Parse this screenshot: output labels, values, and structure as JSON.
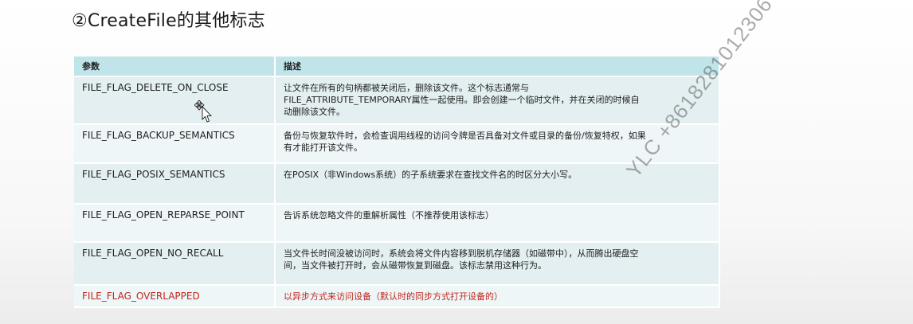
{
  "title": "②CreateFile的其他标志",
  "table": {
    "headers": {
      "param": "参数",
      "desc": "描述"
    },
    "rows": [
      {
        "flag": "FILE_FLAG_DELETE_ON_CLOSE",
        "desc_lines": [
          "让文件在所有的句柄都被关闭后，删除该文件。这个标志通常与",
          "FILE_ATTRIBUTE_TEMPORARY属性一起使用。即会创建一个临时文件，并在关闭的时候自",
          "动删除该文件。"
        ]
      },
      {
        "flag": "FILE_FLAG_BACKUP_SEMANTICS",
        "desc_lines": [
          "备份与恢复软件时，会检查调用线程的访问令牌是否具备对文件或目录的备份/恢复特权，如果",
          "有才能打开该文件。"
        ]
      },
      {
        "flag": "FILE_FLAG_POSIX_SEMANTICS",
        "desc_lines": [
          "在POSIX（非Windows系统）的子系统要求在查找文件名的时区分大小写。"
        ]
      },
      {
        "flag": "FILE_FLAG_OPEN_REPARSE_POINT",
        "desc_lines": [
          "告诉系统忽略文件的重解析属性（不推荐使用该标志）"
        ]
      },
      {
        "flag": "FILE_FLAG_OPEN_NO_RECALL",
        "desc_lines": [
          "当文件长时间没被访问时，系统会将文件内容移到脱机存储器（如磁带中），从而腾出硬盘空",
          "间，当文件被打开时，会从磁带恢复到磁盘。该标志禁用这种行为。"
        ]
      },
      {
        "flag": "FILE_FLAG_OVERLAPPED",
        "desc_lines": [
          "以异步方式来访问设备（默认时的同步方式打开设备的）"
        ]
      }
    ]
  },
  "watermark": "YLC +8618281012306",
  "colors": {
    "header_bg": "#bfe4ea",
    "row_bg_odd": "#e3eff1",
    "row_bg_even": "#eef6f7",
    "highlight_text": "#c0271d"
  }
}
